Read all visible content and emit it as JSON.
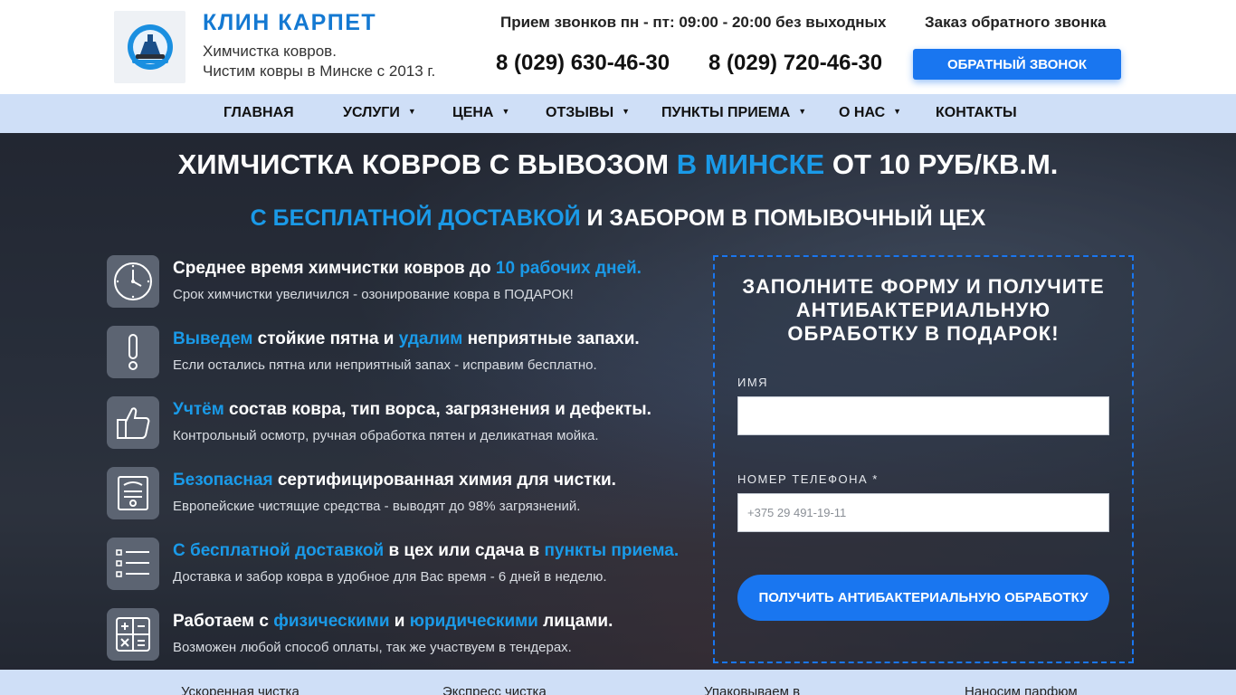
{
  "header": {
    "brand": "КЛИН КАРПЕТ",
    "tagline_1": "Химчистка ковров.",
    "tagline_2": "Чистим ковры в Минске с 2013 г.",
    "hours": "Прием звонков пн - пт: 09:00 - 20:00 без выходных",
    "callback_label": "Заказ обратного звонка",
    "phone_1": "8 (029) 630-46-30",
    "phone_2": "8 (029) 720-46-30",
    "callback_button": "ОБРАТНЫЙ ЗВОНОК"
  },
  "nav": [
    {
      "label": "ГЛАВНАЯ",
      "dropdown": false
    },
    {
      "label": "УСЛУГИ",
      "dropdown": true
    },
    {
      "label": "ЦЕНА",
      "dropdown": true
    },
    {
      "label": "ОТЗЫВЫ",
      "dropdown": true
    },
    {
      "label": "ПУНКТЫ ПРИЕМА",
      "dropdown": true
    },
    {
      "label": "О НАС",
      "dropdown": true
    },
    {
      "label": "КОНТАКТЫ",
      "dropdown": false
    }
  ],
  "hero": {
    "h1_a": "ХИМЧИСТКА КОВРОВ С ВЫВОЗОМ ",
    "h1_b": "В МИНСКЕ",
    "h1_c": " ОТ 10 РУБ/КВ.М.",
    "h2_a": "С БЕСПЛАТНОЙ ДОСТАВКОЙ",
    "h2_b": " И ЗАБОРОМ В ПОМЫВОЧНЫЙ ЦЕХ"
  },
  "features": [
    {
      "icon": "clock-icon",
      "parts": [
        {
          "t": "Среднее время химчистки ковров до ",
          "hl": false
        },
        {
          "t": "10 рабочих дней.",
          "hl": true
        }
      ],
      "text": "Срок химчистки увеличился - озонирование ковра в ПОДАРОК!"
    },
    {
      "icon": "exclamation-icon",
      "parts": [
        {
          "t": "Выведем",
          "hl": true
        },
        {
          "t": " стойкие пятна и ",
          "hl": false
        },
        {
          "t": "удалим",
          "hl": true
        },
        {
          "t": " неприятные запахи.",
          "hl": false
        }
      ],
      "text": "Если остались пятна или неприятный запах - исправим бесплатно."
    },
    {
      "icon": "thumbs-up-icon",
      "parts": [
        {
          "t": "Учтём",
          "hl": true
        },
        {
          "t": " состав ковра, тип ворса, загрязнения и дефекты.",
          "hl": false
        }
      ],
      "text": "Контрольный осмотр, ручная обработка пятен и деликатная мойка."
    },
    {
      "icon": "certificate-icon",
      "parts": [
        {
          "t": "Безопасная",
          "hl": true
        },
        {
          "t": " сертифицированная химия для чистки.",
          "hl": false
        }
      ],
      "text": "Европейские чистящие средства - выводят до 98% загрязнений."
    },
    {
      "icon": "checklist-icon",
      "parts": [
        {
          "t": "С бесплатной доставкой",
          "hl": true
        },
        {
          "t": " в цех или сдача в ",
          "hl": false
        },
        {
          "t": "пункты приема.",
          "hl": true
        }
      ],
      "text": "Доставка и забор ковра в удобное для Вас время - 6 дней в неделю."
    },
    {
      "icon": "calculator-icon",
      "parts": [
        {
          "t": "Работаем с ",
          "hl": false
        },
        {
          "t": "физическими",
          "hl": true
        },
        {
          "t": " и ",
          "hl": false
        },
        {
          "t": "юридическими",
          "hl": true
        },
        {
          "t": " лицами.",
          "hl": false
        }
      ],
      "text": "Возможен любой способ оплаты, так же участвуем в тендерах."
    }
  ],
  "form": {
    "title_1": "ЗАПОЛНИТЕ ФОРМУ И ПОЛУЧИТЕ",
    "title_2": "АНТИБАКТЕРИАЛЬНУЮ",
    "title_3": "ОБРАБОТКУ В ПОДАРОК!",
    "name_label": "ИМЯ",
    "name_value": "",
    "phone_label": "НОМЕР ТЕЛЕФОНА *",
    "phone_placeholder": "+375 29 491-19-11",
    "submit": "ПОЛУЧИТЬ АНТИБАКТЕРИАЛЬНУЮ ОБРАБОТКУ"
  },
  "bottom": [
    "Ускоренная чистка",
    "Экспресс чистка",
    "Упаковываем в",
    "Наносим парфюм"
  ],
  "colors": {
    "accent": "#1976f0",
    "highlight": "#1a9ae8",
    "nav_bg": "#cfdff7",
    "brand": "#1479d2"
  }
}
